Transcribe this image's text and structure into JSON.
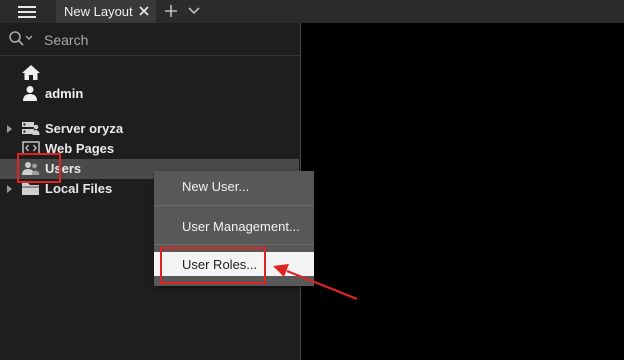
{
  "tabs": [
    {
      "label": "New Layout"
    }
  ],
  "search": {
    "placeholder": "Search"
  },
  "tree": {
    "user": "admin",
    "items": [
      {
        "label": "Server oryza"
      },
      {
        "label": "Web Pages"
      },
      {
        "label": "Users"
      },
      {
        "label": "Local Files"
      }
    ]
  },
  "context_menu": {
    "items": [
      {
        "label": "New User..."
      },
      {
        "label": "User Management..."
      },
      {
        "label": "User Roles..."
      }
    ]
  },
  "colors": {
    "accent_red": "#e02424",
    "selected_row": "#4a4a4a",
    "menu_bg": "#585858"
  },
  "icons": [
    "hamburger-menu-icon",
    "close-icon",
    "plus-icon",
    "chevron-down-icon",
    "search-icon",
    "home-icon",
    "user-icon",
    "server-icon",
    "web-page-icon",
    "users-icon",
    "folder-icon"
  ]
}
